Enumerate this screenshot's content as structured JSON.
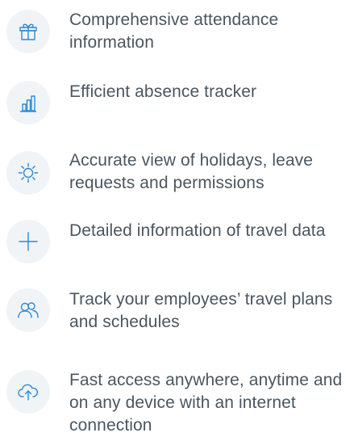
{
  "features": [
    {
      "icon": "gift-icon",
      "text": "Comprehensive  attendance information"
    },
    {
      "icon": "bar-chart-icon",
      "text": "Efficient absence tracker"
    },
    {
      "icon": "sun-icon",
      "text": "Accurate view of holidays, leave requests and permissions"
    },
    {
      "icon": "plus-icon",
      "text": "Detailed information of travel data"
    },
    {
      "icon": "users-icon",
      "text": "Track your employees’ travel plans and schedules"
    },
    {
      "icon": "cloud-upload-icon",
      "text": "Fast access anywhere, anytime and on any device with an internet connection"
    }
  ],
  "colors": {
    "icon": "#2a8ad6",
    "icon_background": "#f1f4f7",
    "text": "#4a5660"
  }
}
